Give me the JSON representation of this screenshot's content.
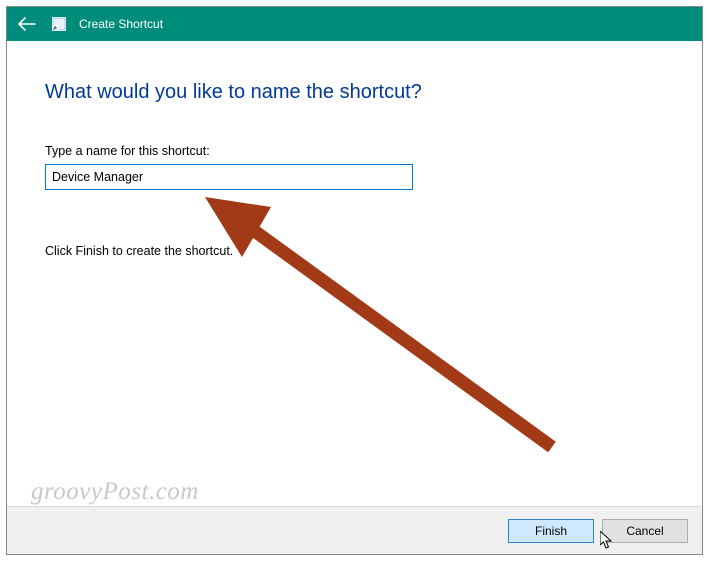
{
  "titlebar": {
    "title": "Create Shortcut"
  },
  "content": {
    "heading": "What would you like to name the shortcut?",
    "field_label": "Type a name for this shortcut:",
    "input_value": "Device Manager",
    "instruction": "Click Finish to create the shortcut."
  },
  "buttons": {
    "finish": "Finish",
    "cancel": "Cancel"
  },
  "watermark": "groovyPost.com",
  "colors": {
    "titlebar_bg": "#008c7a",
    "heading": "#003a99",
    "input_border": "#0078d4",
    "arrow": "#a33a17"
  }
}
